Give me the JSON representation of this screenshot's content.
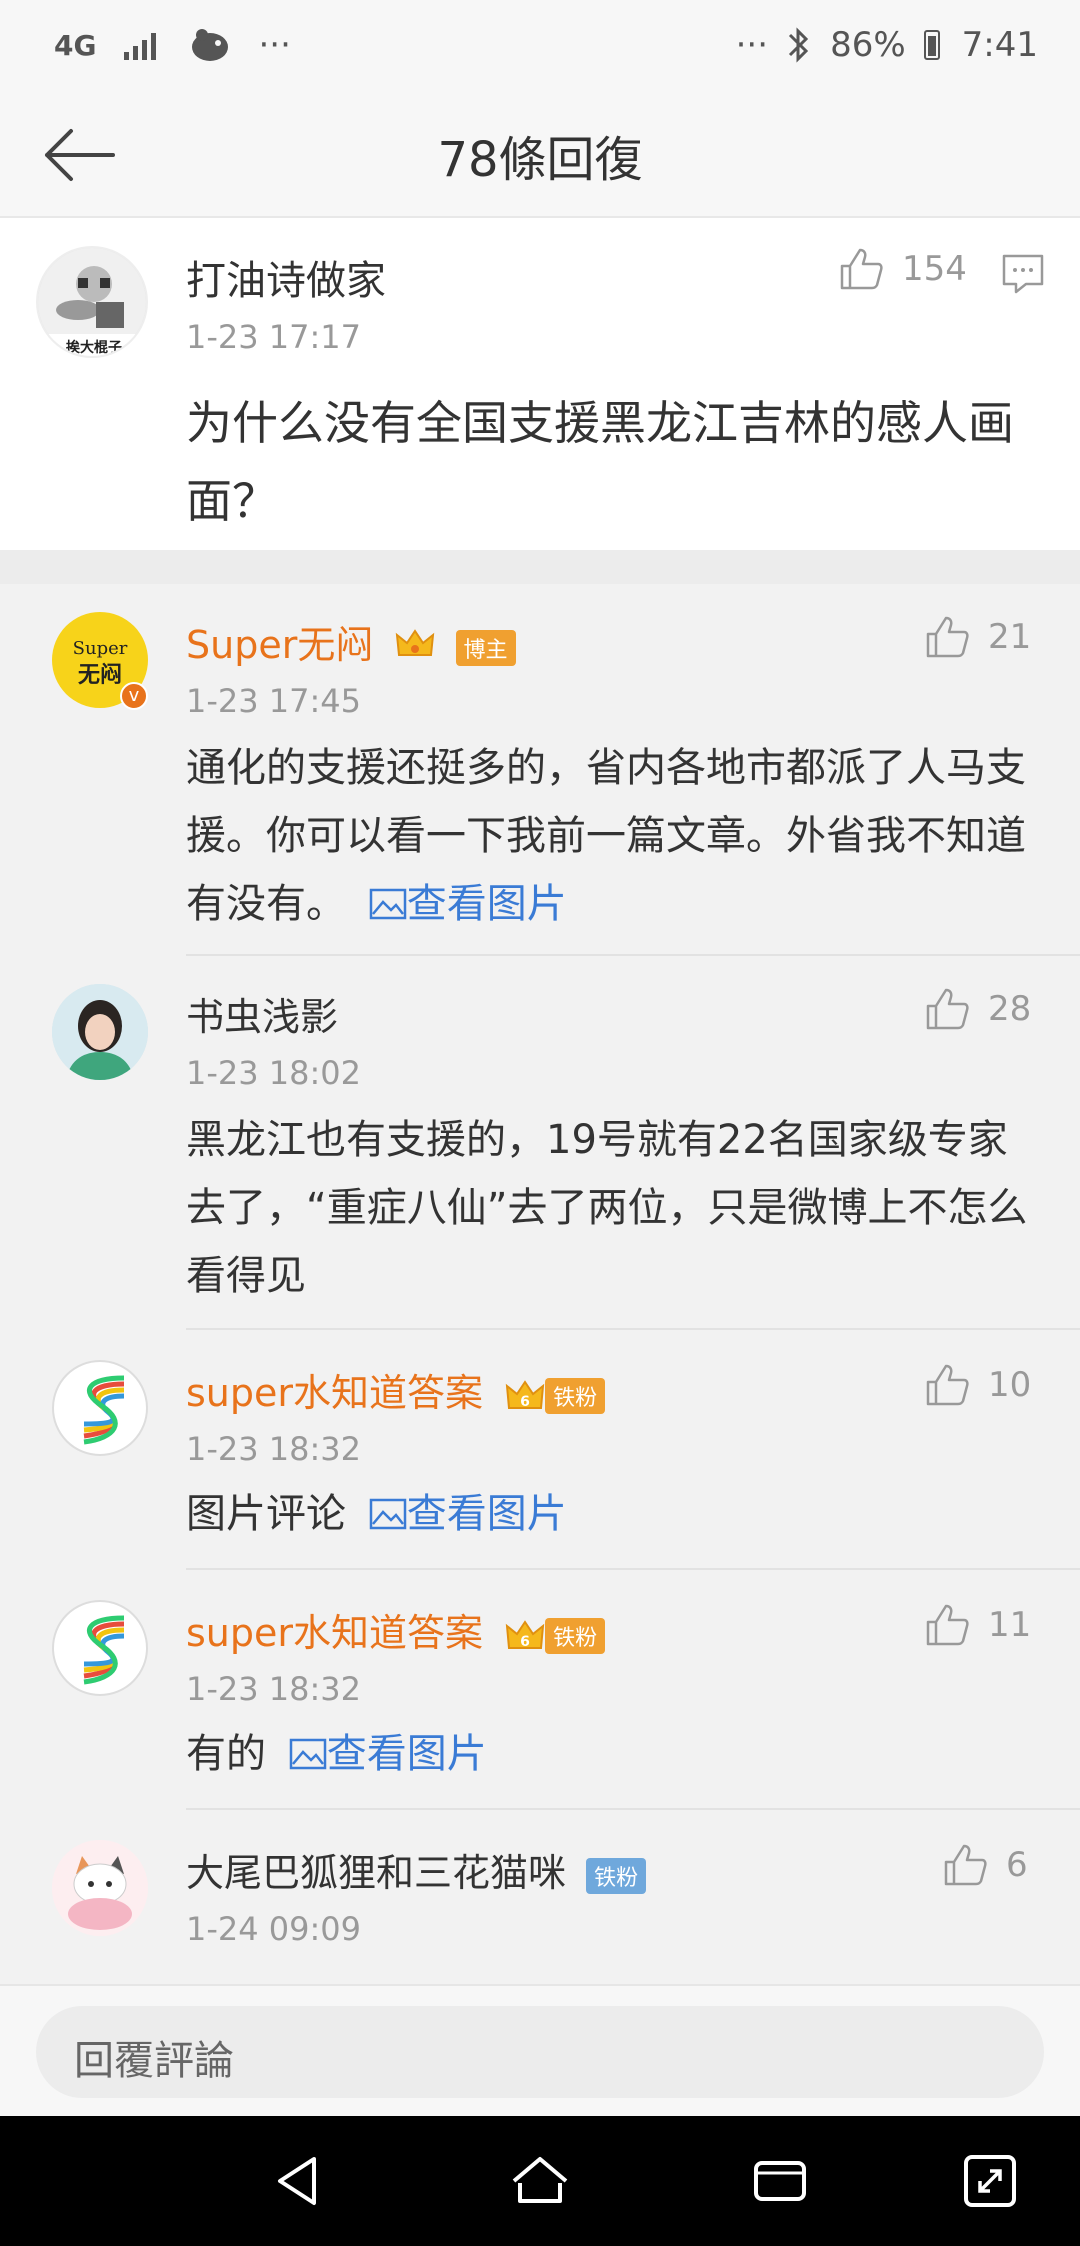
{
  "status_bar": {
    "network": "4G",
    "more_left": "···",
    "more_right": "···",
    "battery": "86%",
    "time": "7:41"
  },
  "header": {
    "title": "78條回復"
  },
  "main_comment": {
    "author": "打油诗做家",
    "avatar_text": "挨大棍子",
    "time": "1-23 17:17",
    "likes": "154",
    "text": "为什么没有全国支援黑龙江吉林的感人画面？"
  },
  "replies": [
    {
      "author": "Super无闷",
      "avatar_text_top": "Super",
      "avatar_text_bottom": "无闷",
      "badge": "博主",
      "time": "1-23 17:45",
      "likes": "21",
      "text": "通化的支援还挺多的，省内各地市都派了人马支援。你可以看一下我前一篇文章。外省我不知道有没有。",
      "link": "查看图片"
    },
    {
      "author": "书虫浅影",
      "time": "1-23 18:02",
      "likes": "28",
      "text": "黑龙江也有支援的，19号就有22名国家级专家去了，“重症八仙”去了两位，只是微博上不怎么看得见"
    },
    {
      "author": "super水知道答案",
      "badge": "铁粉",
      "badge_num": "6",
      "time": "1-23 18:32",
      "likes": "10",
      "text": "图片评论",
      "link": "查看图片"
    },
    {
      "author": "super水知道答案",
      "badge": "铁粉",
      "badge_num": "6",
      "time": "1-23 18:32",
      "likes": "11",
      "text": "有的",
      "link": "查看图片"
    },
    {
      "author": "大尾巴狐狸和三花猫咪",
      "badge": "铁粉",
      "time": "1-24 09:09",
      "likes": "6"
    }
  ],
  "input": {
    "placeholder": "回覆評論"
  },
  "colors": {
    "orange_name": "#e8731b",
    "link_blue": "#3a7bd5",
    "badge_orange": "#f0a030",
    "badge_blue": "#6fa8dc"
  }
}
